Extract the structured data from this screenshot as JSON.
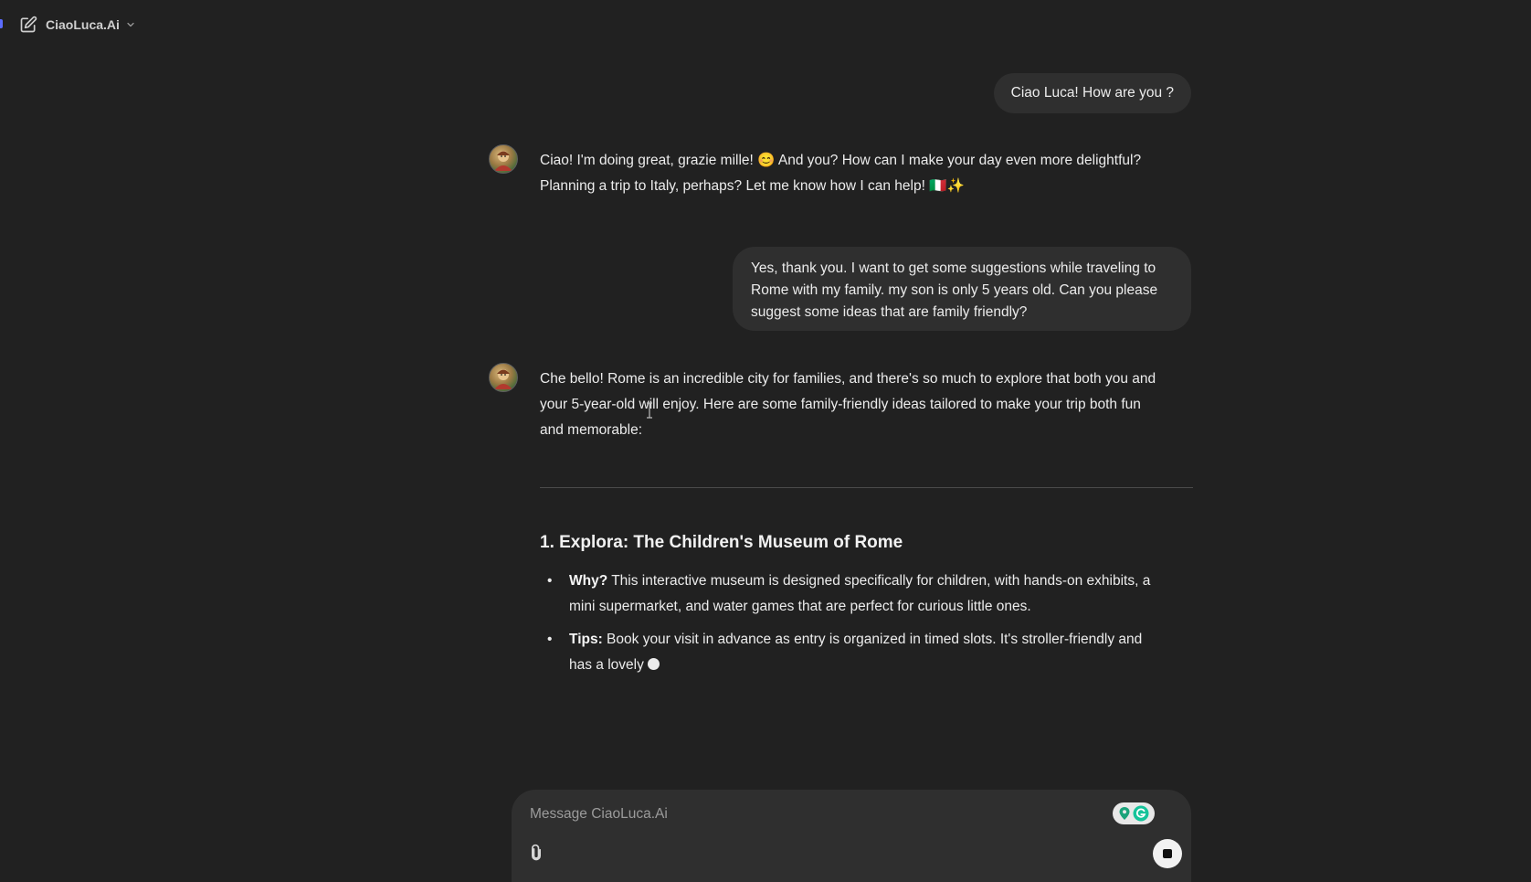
{
  "header": {
    "model_name": "CiaoLuca.Ai",
    "icons": {
      "new_chat": "edit-icon",
      "dropdown": "chevron-down-icon"
    }
  },
  "conversation": [
    {
      "role": "user",
      "text": "Ciao Luca! How are you ?"
    },
    {
      "role": "assistant",
      "line1": "Ciao! I'm doing great, grazie mille! 😊 And you? How can I make your day even more delightful?",
      "line2": "Planning a trip to Italy, perhaps? Let me know how I can help! 🇮🇹✨"
    },
    {
      "role": "user",
      "line1": "Yes, thank you. I want to get some suggestions while traveling to",
      "line2": "Rome with my family. my son is only 5 years old. Can you please",
      "line3": "suggest some ideas that are family friendly?"
    },
    {
      "role": "assistant",
      "line1": "Che bello! Rome is an incredible city for families, and there's so much to explore that both you and",
      "line2": "your 5-year-old will enjoy. Here are some family-friendly ideas tailored to make your trip both fun",
      "line3": "and memorable:",
      "heading": "1. Explora: The Children's Museum of Rome",
      "bullets": [
        {
          "label": "Why?",
          "line1": " This interactive museum is designed specifically for children, with hands-on exhibits, a",
          "line2": "mini supermarket, and water games that are perfect for curious little ones."
        },
        {
          "label": "Tips:",
          "line1": " Book your visit in advance as entry is organized in timed slots. It's stroller-friendly and",
          "line2": "has a lovely"
        }
      ]
    }
  ],
  "composer": {
    "placeholder": "Message CiaoLuca.Ai",
    "value": "",
    "icons": {
      "attach": "paperclip-icon",
      "stop": "stop-icon",
      "extension": "grammarly-icon"
    }
  },
  "colors": {
    "background": "#212121",
    "bubble": "#2f2f2f",
    "text": "#ececec",
    "accent": "#5b6cff"
  }
}
